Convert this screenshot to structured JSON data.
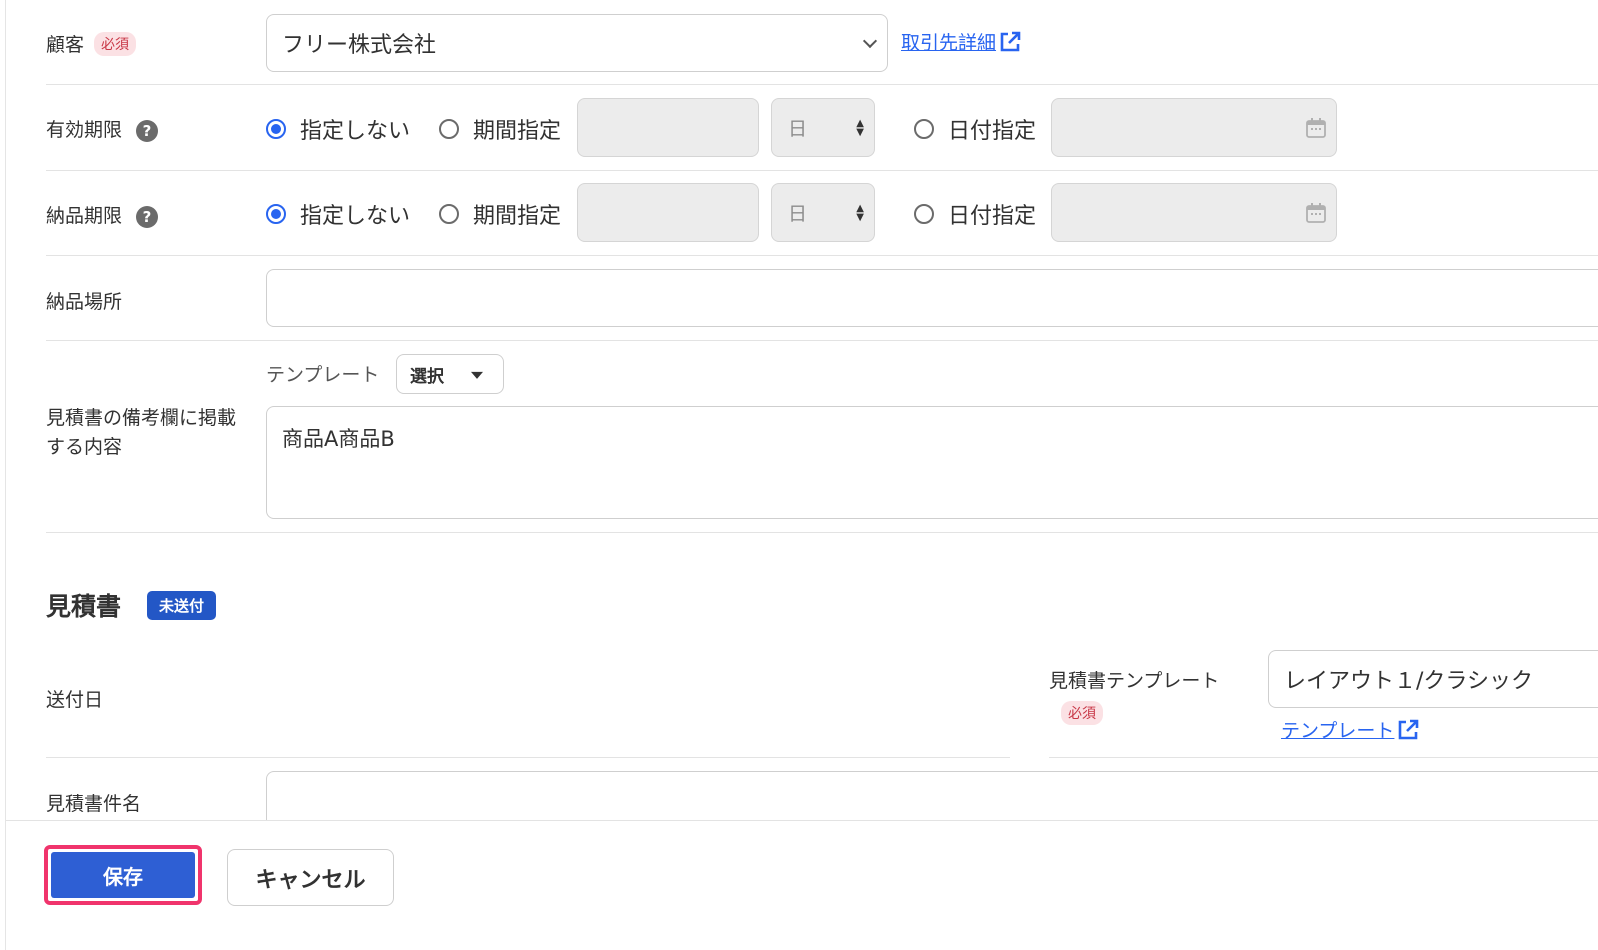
{
  "customer": {
    "label": "顧客",
    "required": "必須",
    "value": "フリー株式会社",
    "detail_link": "取引先詳細"
  },
  "validity": {
    "label": "有効期限",
    "help": "?",
    "option_none": "指定しない",
    "option_period": "期間指定",
    "unit": "日",
    "option_date": "日付指定"
  },
  "delivery_deadline": {
    "label": "納品期限",
    "help": "?",
    "option_none": "指定しない",
    "option_period": "期間指定",
    "unit": "日",
    "option_date": "日付指定"
  },
  "delivery_place": {
    "label": "納品場所",
    "value": ""
  },
  "remarks": {
    "label_line1": "見積書の備考欄に掲載",
    "label_line2": "する内容",
    "template_label": "テンプレート",
    "template_button": "選択",
    "value": "商品A商品B"
  },
  "quote_section": {
    "title": "見積書",
    "status": "未送付"
  },
  "send_date": {
    "label": "送付日"
  },
  "quote_template": {
    "label": "見積書テンプレート",
    "required": "必須",
    "value": "レイアウト１/クラシック",
    "link": "テンプレート"
  },
  "quote_subject": {
    "label": "見積書件名",
    "value": ""
  },
  "footer": {
    "save": "保存",
    "cancel": "キャンセル"
  },
  "colors": {
    "accent": "#2864f0",
    "primary_button": "#2e5fd4",
    "highlight_border": "#f0346c",
    "required_badge_bg": "#fbe1e4",
    "status_badge_bg": "#2357c6"
  }
}
